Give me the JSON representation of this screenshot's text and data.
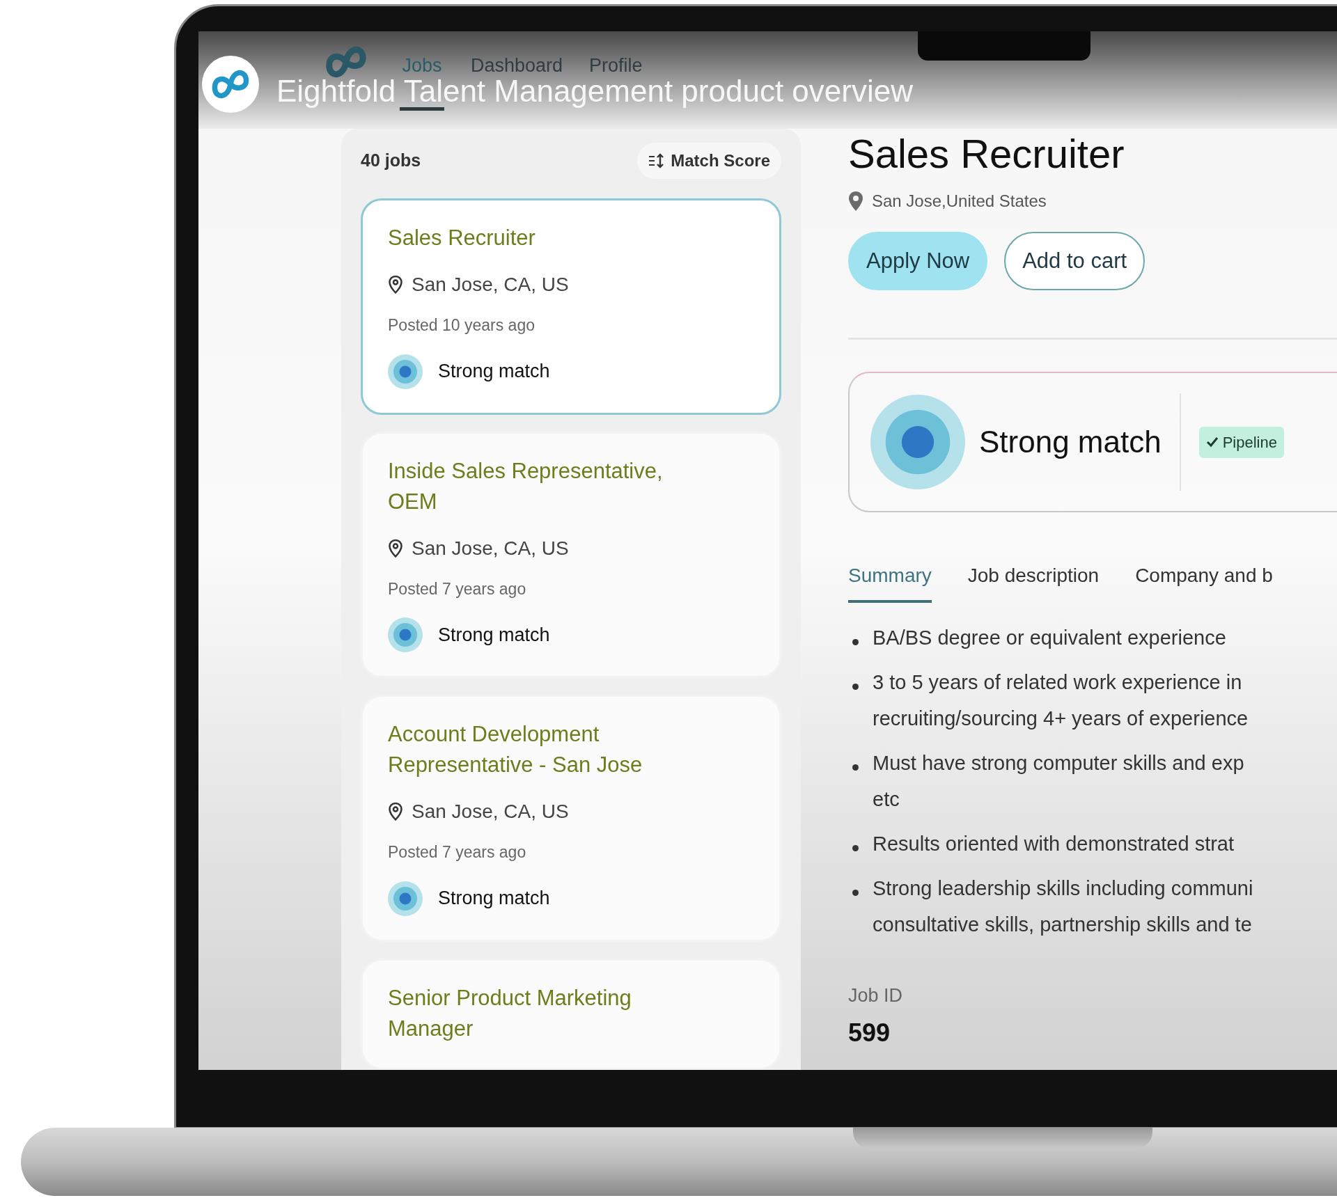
{
  "video_title": "Eightfold Talent Management product overview",
  "nav": [
    {
      "label": "Jobs",
      "selected": true
    },
    {
      "label": "Dashboard",
      "selected": false
    },
    {
      "label": "Profile",
      "selected": false
    }
  ],
  "job_list": {
    "count": "40 jobs",
    "sort": "Match Score",
    "jobs": [
      {
        "title": "Sales Recruiter",
        "location": "San Jose, CA, US",
        "posted": "Posted 10 years ago",
        "match": "Strong match",
        "selected": true
      },
      {
        "title": "Inside Sales Representative, OEM",
        "location": "San Jose, CA, US",
        "posted": "Posted 7 years ago",
        "match": "Strong match",
        "selected": false
      },
      {
        "title": "Account Development Representative - San Jose",
        "location": "San Jose, CA, US",
        "posted": "Posted 7 years ago",
        "match": "Strong match",
        "selected": false
      },
      {
        "title": "Senior Product Marketing Manager",
        "selected": false
      }
    ]
  },
  "detail": {
    "title": "Sales Recruiter",
    "location": "San Jose,United States",
    "buttons": [
      {
        "label": "Apply Now",
        "kind": "primary"
      },
      {
        "label": "Add to cart",
        "kind": "outline"
      }
    ],
    "match": "Strong match",
    "badges": [
      "Pipeline"
    ],
    "tabs": [
      {
        "label": "Summary",
        "selected": true
      },
      {
        "label": "Job description",
        "selected": false
      },
      {
        "label": "Company and b",
        "selected": false
      }
    ],
    "summary": [
      {
        "lines": [
          "BA/BS degree or equivalent experience"
        ]
      },
      {
        "lines": [
          "3 to 5 years of related work experience in",
          "recruiting/sourcing 4+ years of experience"
        ]
      },
      {
        "lines": [
          "Must have strong computer skills and exp",
          "etc"
        ]
      },
      {
        "lines": [
          "Results oriented with demonstrated strat"
        ]
      },
      {
        "lines": [
          "Strong leadership skills including communi",
          "consultative skills, partnership skills and te"
        ]
      }
    ],
    "job_id_label": "Job ID",
    "job_id": "599"
  }
}
